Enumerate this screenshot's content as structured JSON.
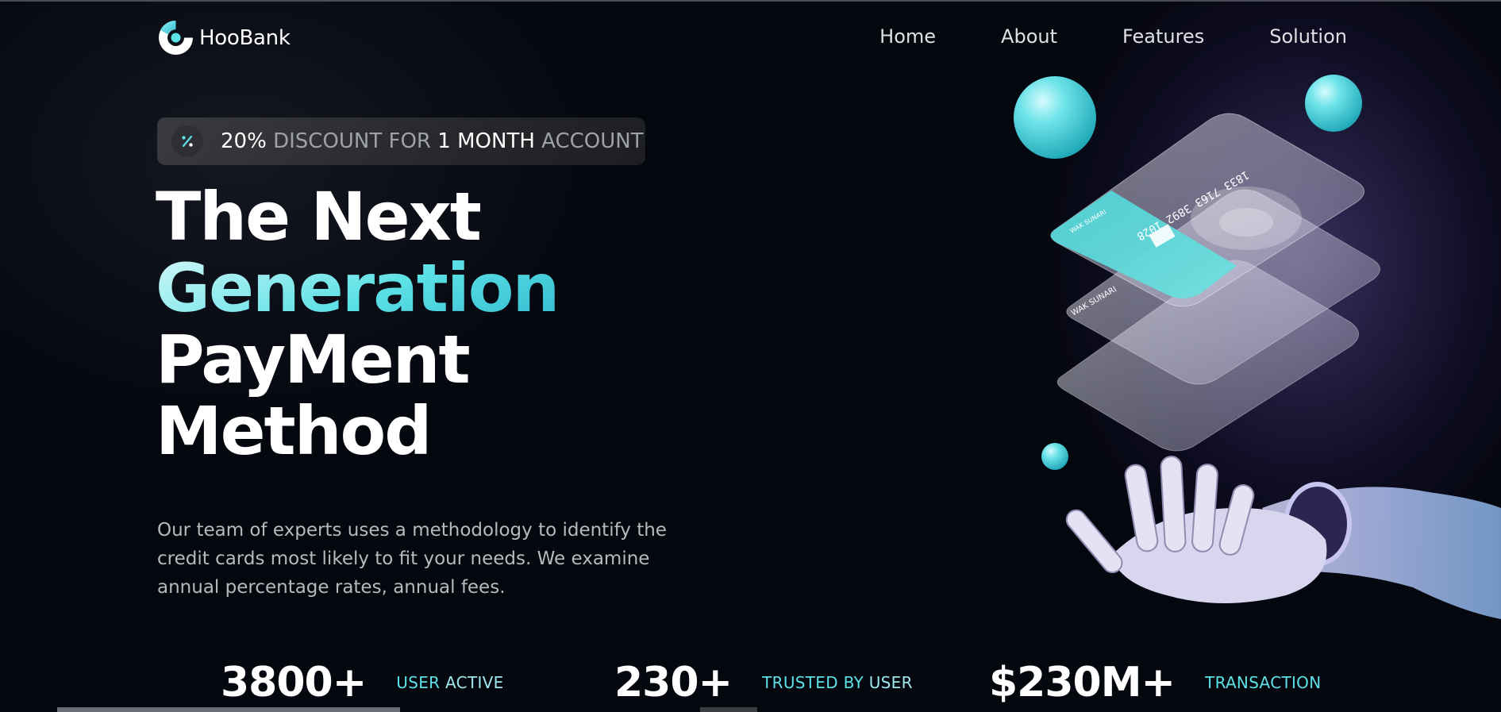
{
  "brand": {
    "name": "HooBank",
    "accent": "#5ce1e6",
    "background": "#00040f"
  },
  "nav": {
    "items": [
      "Home",
      "About",
      "Features",
      "Solution"
    ]
  },
  "discount": {
    "icon": "discount-percent-icon",
    "pct": "20%",
    "word1": "DISCOUNT",
    "word2": "FOR",
    "one": "1",
    "month": "MONTH",
    "account": "ACCOUNT"
  },
  "hero": {
    "line1": "The Next",
    "line2": "Generation",
    "line3": "PayMent",
    "line4": "Method",
    "description": "Our team of experts uses a methodology to identify the credit cards most likely to fit your needs. We examine annual percentage rates, annual fees."
  },
  "stats": [
    {
      "value": "3800+",
      "label_a": "USER",
      "label_b": "ACTIVE"
    },
    {
      "value": "230+",
      "label_a": "TRUSTED BY",
      "label_b": "USER"
    },
    {
      "value": "$230M+",
      "label_a": "TRANSACTION",
      "label_b": ""
    }
  ],
  "card": {
    "number": "1833 7163 3892 1028",
    "holder": "WAK SUNARI"
  }
}
